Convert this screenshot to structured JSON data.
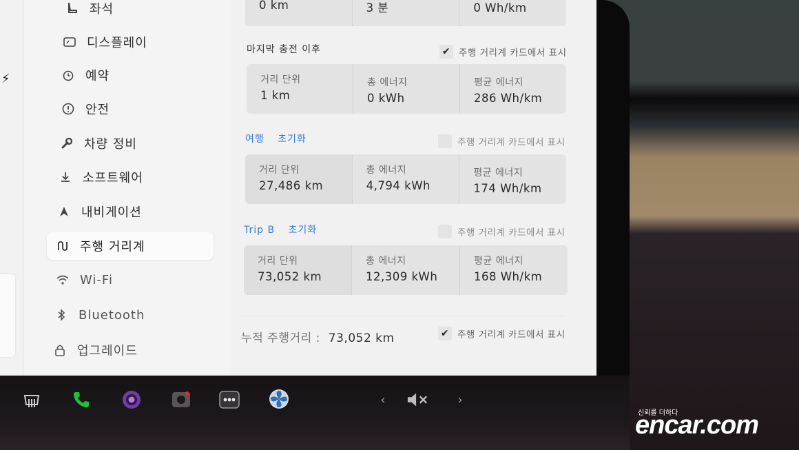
{
  "sidebar": {
    "items": [
      {
        "label": "좌석",
        "icon": "seat-icon"
      },
      {
        "label": "디스플레이",
        "icon": "display-icon"
      },
      {
        "label": "예약",
        "icon": "alarm-icon"
      },
      {
        "label": "안전",
        "icon": "info-icon"
      },
      {
        "label": "차량 정비",
        "icon": "wrench-icon"
      },
      {
        "label": "소프트웨어",
        "icon": "download-icon"
      },
      {
        "label": "내비게이션",
        "icon": "navigation-icon"
      },
      {
        "label": "주행 거리계",
        "icon": "trip-icon",
        "active": true
      },
      {
        "label": "Wi-Fi",
        "icon": "wifi-icon"
      },
      {
        "label": "Bluetooth",
        "icon": "bluetooth-icon"
      },
      {
        "label": "업그레이드",
        "icon": "lock-icon"
      }
    ]
  },
  "top_row": {
    "values": [
      "0 km",
      "3 분",
      "0 Wh/km"
    ]
  },
  "last_charge": {
    "title": "마지막 충전 이후",
    "toggle_label": "주행 거리계 카드에서 표시",
    "toggle_checked": true,
    "stats": [
      {
        "label": "거리 단위",
        "value": "1 km"
      },
      {
        "label": "총 에너지",
        "value": "0 kWh"
      },
      {
        "label": "평균 에너지",
        "value": "286 Wh/km"
      }
    ]
  },
  "trip_a": {
    "name": "여행",
    "reset": "초기화",
    "toggle_label": "주행 거리계 카드에서 표시",
    "toggle_checked": false,
    "stats": [
      {
        "label": "거리 단위",
        "value": "27,486 km"
      },
      {
        "label": "총 에너지",
        "value": "4,794 kWh"
      },
      {
        "label": "평균 에너지",
        "value": "174 Wh/km"
      }
    ]
  },
  "trip_b": {
    "name": "Trip B",
    "reset": "초기화",
    "toggle_label": "주행 거리계 카드에서 표시",
    "toggle_checked": false,
    "stats": [
      {
        "label": "거리 단위",
        "value": "73,052 km"
      },
      {
        "label": "총 에너지",
        "value": "12,309 kWh"
      },
      {
        "label": "평균 에너지",
        "value": "168 Wh/km"
      }
    ]
  },
  "odometer": {
    "label": "누적 주행거리 :",
    "value": "73,052 km",
    "toggle_label": "주행 거리계 카드에서 표시",
    "toggle_checked": true
  },
  "taskbar": {
    "icons": [
      "seat-heater-icon",
      "phone-icon",
      "camera-app-icon",
      "dashcam-icon",
      "more-icon",
      "fan-icon",
      "prev-icon",
      "mute-icon",
      "next-icon"
    ]
  },
  "watermark": {
    "tag": "신뢰를 더하다",
    "brand": "encar.com"
  },
  "colors": {
    "accent": "#3478d6",
    "phone": "#1fbf3a"
  }
}
